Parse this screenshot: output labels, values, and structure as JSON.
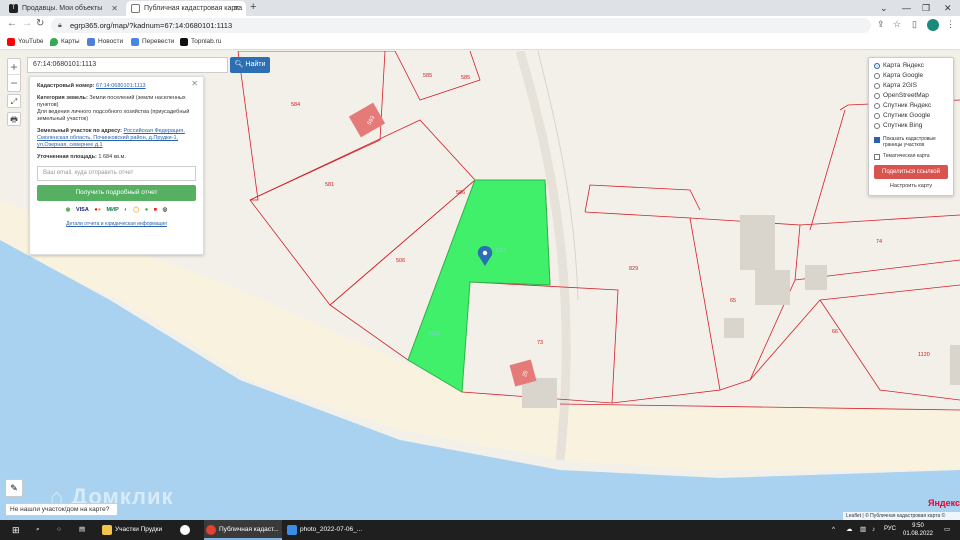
{
  "browser": {
    "tabs": [
      {
        "title": "Продавцы. Мои объекты",
        "favicon": "T"
      },
      {
        "title": "Публичная кадастровая карта",
        "favicon": "map"
      }
    ],
    "url": "egrp365.org/map/?kadnum=67:14:0680101:1113",
    "bookmarks": [
      "YouTube",
      "Карты",
      "Новости",
      "Перевести",
      "Topnlab.ru"
    ]
  },
  "search": {
    "value": "67:14:0680101:1113",
    "button": "Найти"
  },
  "info": {
    "kadnum_label": "Кадастровый номер:",
    "kadnum_value": "67:14:0680101:1113",
    "category_label": "Категория земель:",
    "category_value": "Земли поселений (земли населенных пунктов)",
    "usage": "Для ведения личного подсобного хозяйства (приусадебный земельный участок)",
    "address_label": "Земельный участок по адресу:",
    "address_value": "Российская Федерация, Смоленская область, Починковский район, д.Прудки-1, ул.Озерная, севернее д.1",
    "area_label": "Уточненная площадь:",
    "area_value": "1 684 кв.м.",
    "email_placeholder": "Ваш email, куда отправить отчет",
    "get_report": "Получить подробный отчет",
    "payments": [
      "VISA",
      "MC",
      "МИР"
    ],
    "details_link": "Детали отчета и юридическая информация"
  },
  "layers": {
    "options": [
      "Карта Яндекс",
      "Карта Google",
      "Карта 2GIS",
      "OpenStreetMap",
      "Спутник Яндекс",
      "Спутник Google",
      "Спутник Bing"
    ],
    "selected": 0,
    "show_borders": "Показать кадастровые границы участков",
    "thematic": "Тематическая карта",
    "share": "Поделиться ссылкой",
    "setup": "Настроить карту"
  },
  "map_labels": {
    "parcels": [
      "585",
      "585",
      "584",
      "581",
      "586",
      "506",
      "1113",
      "829",
      "65",
      "74",
      "66",
      "1120",
      "73",
      "1113"
    ],
    "buildings": [
      "593",
      "25",
      "24"
    ]
  },
  "overlay": {
    "watermark": "Домклик",
    "not_found": "Не нашли участок/дом на карте?",
    "leaflet": "Leaflet | © Публичная кадастровая карта ©",
    "yandex": "Яндекс"
  },
  "taskbar": {
    "apps": [
      "Участки Прудки",
      "Публичная кадаст...",
      "photo_2022-07-06_..."
    ],
    "lang": "РУС",
    "time": "9:50",
    "date": "01.08.2022"
  },
  "colors": {
    "selected_parcel": "#41f06a",
    "parcel_border": "#d4202a",
    "water": "#a8d2f0",
    "sand": "#f8f2df"
  }
}
